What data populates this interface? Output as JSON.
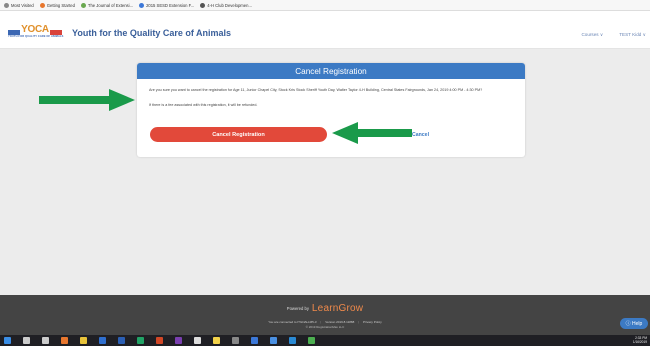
{
  "bookmarks": [
    {
      "label": "Most Visited",
      "color": "#888888"
    },
    {
      "label": "Getting Started",
      "color": "#e8772e"
    },
    {
      "label": "The Journal of Extensi...",
      "color": "#6aa84f"
    },
    {
      "label": "2015 SESD Extension F...",
      "color": "#3c78d8"
    },
    {
      "label": "4-H Club Developmen...",
      "color": "#555555"
    }
  ],
  "header": {
    "logo_word": "YOCA",
    "logo_tagline": "YOUTH FOR QUALITY CARE OF ANIMALS",
    "site_title": "Youth for the Quality Care of Animals",
    "nav": [
      "Courses  ∨",
      "TEST Kidd  ∨"
    ]
  },
  "modal": {
    "title": "Cancel Registration",
    "message": "Are you sure you want to cancel the registration for Age 11, Junior Chapel City, Stock Kris Stock Sheriff Youth Day, Walter Taylor 4-H Building, Central States Fairgrounds, Jan 24, 2019 4:00 PM - 4:30 PM?",
    "fee_note": "If there is a fee associated with this registration, it will be refunded.",
    "confirm_label": "Cancel Registration",
    "cancel_label": "Cancel"
  },
  "footer": {
    "powered_by": "Powered by",
    "brand": "LearnGrow",
    "links": [
      "You are connected to ITGNAH-M5-3",
      "Version 2019.8.11888",
      "Privacy Policy"
    ],
    "copyright": "© 2019 RegistrationMax LLC"
  },
  "help_label": "ⓘ Help",
  "clock": {
    "time": "2:33 PM",
    "date": "1/16/2019"
  },
  "colors": {
    "accent": "#3c7ac4",
    "danger": "#e2493a",
    "annotation_arrow": "#1a9a4a"
  },
  "taskbar_icons": [
    {
      "name": "windows-start-icon",
      "color": "#3a8ee6"
    },
    {
      "name": "search-icon",
      "color": "#cccccc"
    },
    {
      "name": "task-view-icon",
      "color": "#cccccc"
    },
    {
      "name": "firefox-icon",
      "color": "#e8772e"
    },
    {
      "name": "file-explorer-icon",
      "color": "#e8c33a"
    },
    {
      "name": "outlook-icon",
      "color": "#2f6fcf"
    },
    {
      "name": "word-icon",
      "color": "#2b5fb4"
    },
    {
      "name": "excel-icon",
      "color": "#21a366"
    },
    {
      "name": "powerpoint-icon",
      "color": "#d24726"
    },
    {
      "name": "onenote-icon",
      "color": "#7a3fb0"
    },
    {
      "name": "paint-icon",
      "color": "#dddddd"
    },
    {
      "name": "sticky-notes-icon",
      "color": "#f3d34a"
    },
    {
      "name": "calculator-icon",
      "color": "#888888"
    },
    {
      "name": "photos-icon",
      "color": "#3c78d8"
    },
    {
      "name": "mail-icon",
      "color": "#4a90e2"
    },
    {
      "name": "edge-icon",
      "color": "#2a8ad4"
    },
    {
      "name": "chrome-icon",
      "color": "#4caf50"
    }
  ]
}
